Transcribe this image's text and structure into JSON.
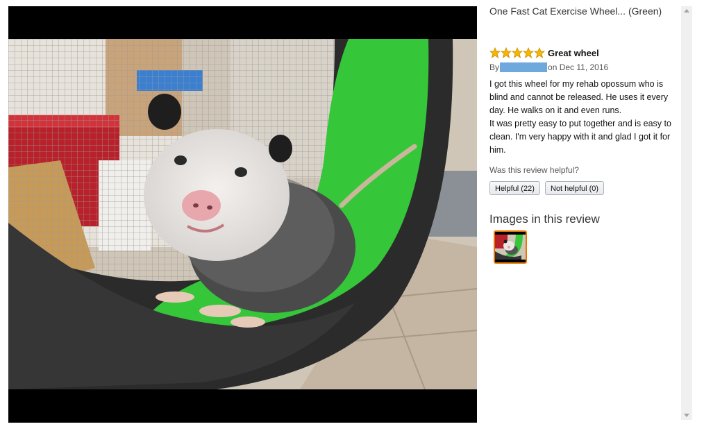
{
  "product": {
    "title": "One Fast Cat Exercise Wheel... (Green)"
  },
  "review": {
    "rating": 5,
    "rating_max": 5,
    "title": "Great wheel",
    "by_label": "By",
    "date_text": "on Dec 11, 2016",
    "body": [
      "I got this wheel for my rehab opossum who is blind and cannot be released. He uses it every day. He walks on it and even runs.",
      "It was pretty easy to put together and is easy to clean. I'm very happy with it and glad I got it for him."
    ],
    "helpful_question": "Was this review helpful?",
    "helpful_button": "Helpful (22)",
    "not_helpful_button": "Not helpful (0)"
  },
  "images_section": {
    "heading": "Images in this review"
  },
  "colors": {
    "star": "#f7b600",
    "wheel_green": "#35c63a",
    "selected_border": "#e77600",
    "redaction": "#6fa8dc"
  },
  "icons": {
    "star": "star-icon",
    "scroll_up": "scroll-up-arrow-icon",
    "scroll_down": "scroll-down-arrow-icon"
  }
}
